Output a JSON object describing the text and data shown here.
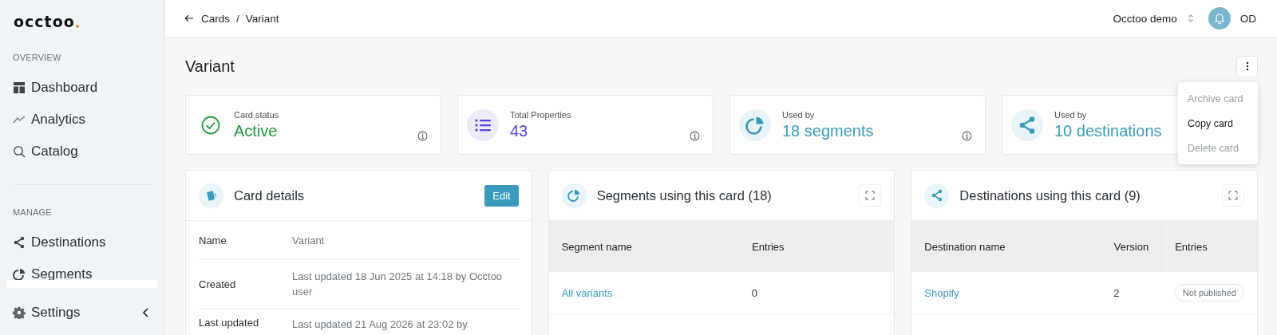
{
  "sidebar": {
    "logo": "occtoo",
    "sections": [
      {
        "heading": "OVERVIEW",
        "items": [
          {
            "label": "Dashboard",
            "kind": "dashboard"
          },
          {
            "label": "Analytics",
            "kind": "analytics"
          },
          {
            "label": "Catalog",
            "kind": "search"
          }
        ]
      },
      {
        "heading": "MANAGE",
        "items": [
          {
            "label": "Destinations",
            "kind": "share"
          },
          {
            "label": "Segments",
            "kind": "pie"
          }
        ]
      }
    ],
    "footer": {
      "label": "Settings"
    }
  },
  "header": {
    "breadcrumb": [
      "Cards",
      "Variant"
    ],
    "separator": "/",
    "workspace": "Occtoo demo",
    "user_initials": "OD"
  },
  "page_title": "Variant",
  "stats": [
    {
      "label": "Card status",
      "value": "Active",
      "kind": "check",
      "color": "#1f9a3b"
    },
    {
      "label": "Total Properties",
      "value": "43",
      "kind": "list",
      "color": "#5b3fe0"
    },
    {
      "label": "Used by",
      "value": "18 segments",
      "kind": "pie",
      "color": "#3a9bbd"
    },
    {
      "label": "Used by",
      "value": "10 destinations",
      "kind": "share",
      "color": "#3a9bbd"
    }
  ],
  "menu": {
    "items": [
      {
        "label": "Archive card",
        "disabled": true
      },
      {
        "label": "Copy card",
        "disabled": false
      },
      {
        "label": "Delete card",
        "disabled": true
      }
    ]
  },
  "details": {
    "title": "Card details",
    "edit": "Edit",
    "rows": [
      {
        "label": "Name",
        "value": "Variant"
      },
      {
        "label": "Created",
        "value": "Last updated 18 Jun 2025 at 14:18 by Occtoo user"
      },
      {
        "label": "Last updated",
        "value": "Last updated 21 Aug 2026 at 23:02 by"
      }
    ]
  },
  "segments": {
    "title": "Segments using this card (18)",
    "columns": [
      "Segment name",
      "Entries"
    ],
    "rows": [
      [
        "All variants",
        "0"
      ]
    ]
  },
  "destinations": {
    "title": "Destinations using this card (9)",
    "columns": [
      "Destination name",
      "Version",
      "Entries"
    ],
    "rows": [
      {
        "name": "Shopify",
        "version": "2",
        "status": "Not published",
        "published": false
      }
    ]
  }
}
